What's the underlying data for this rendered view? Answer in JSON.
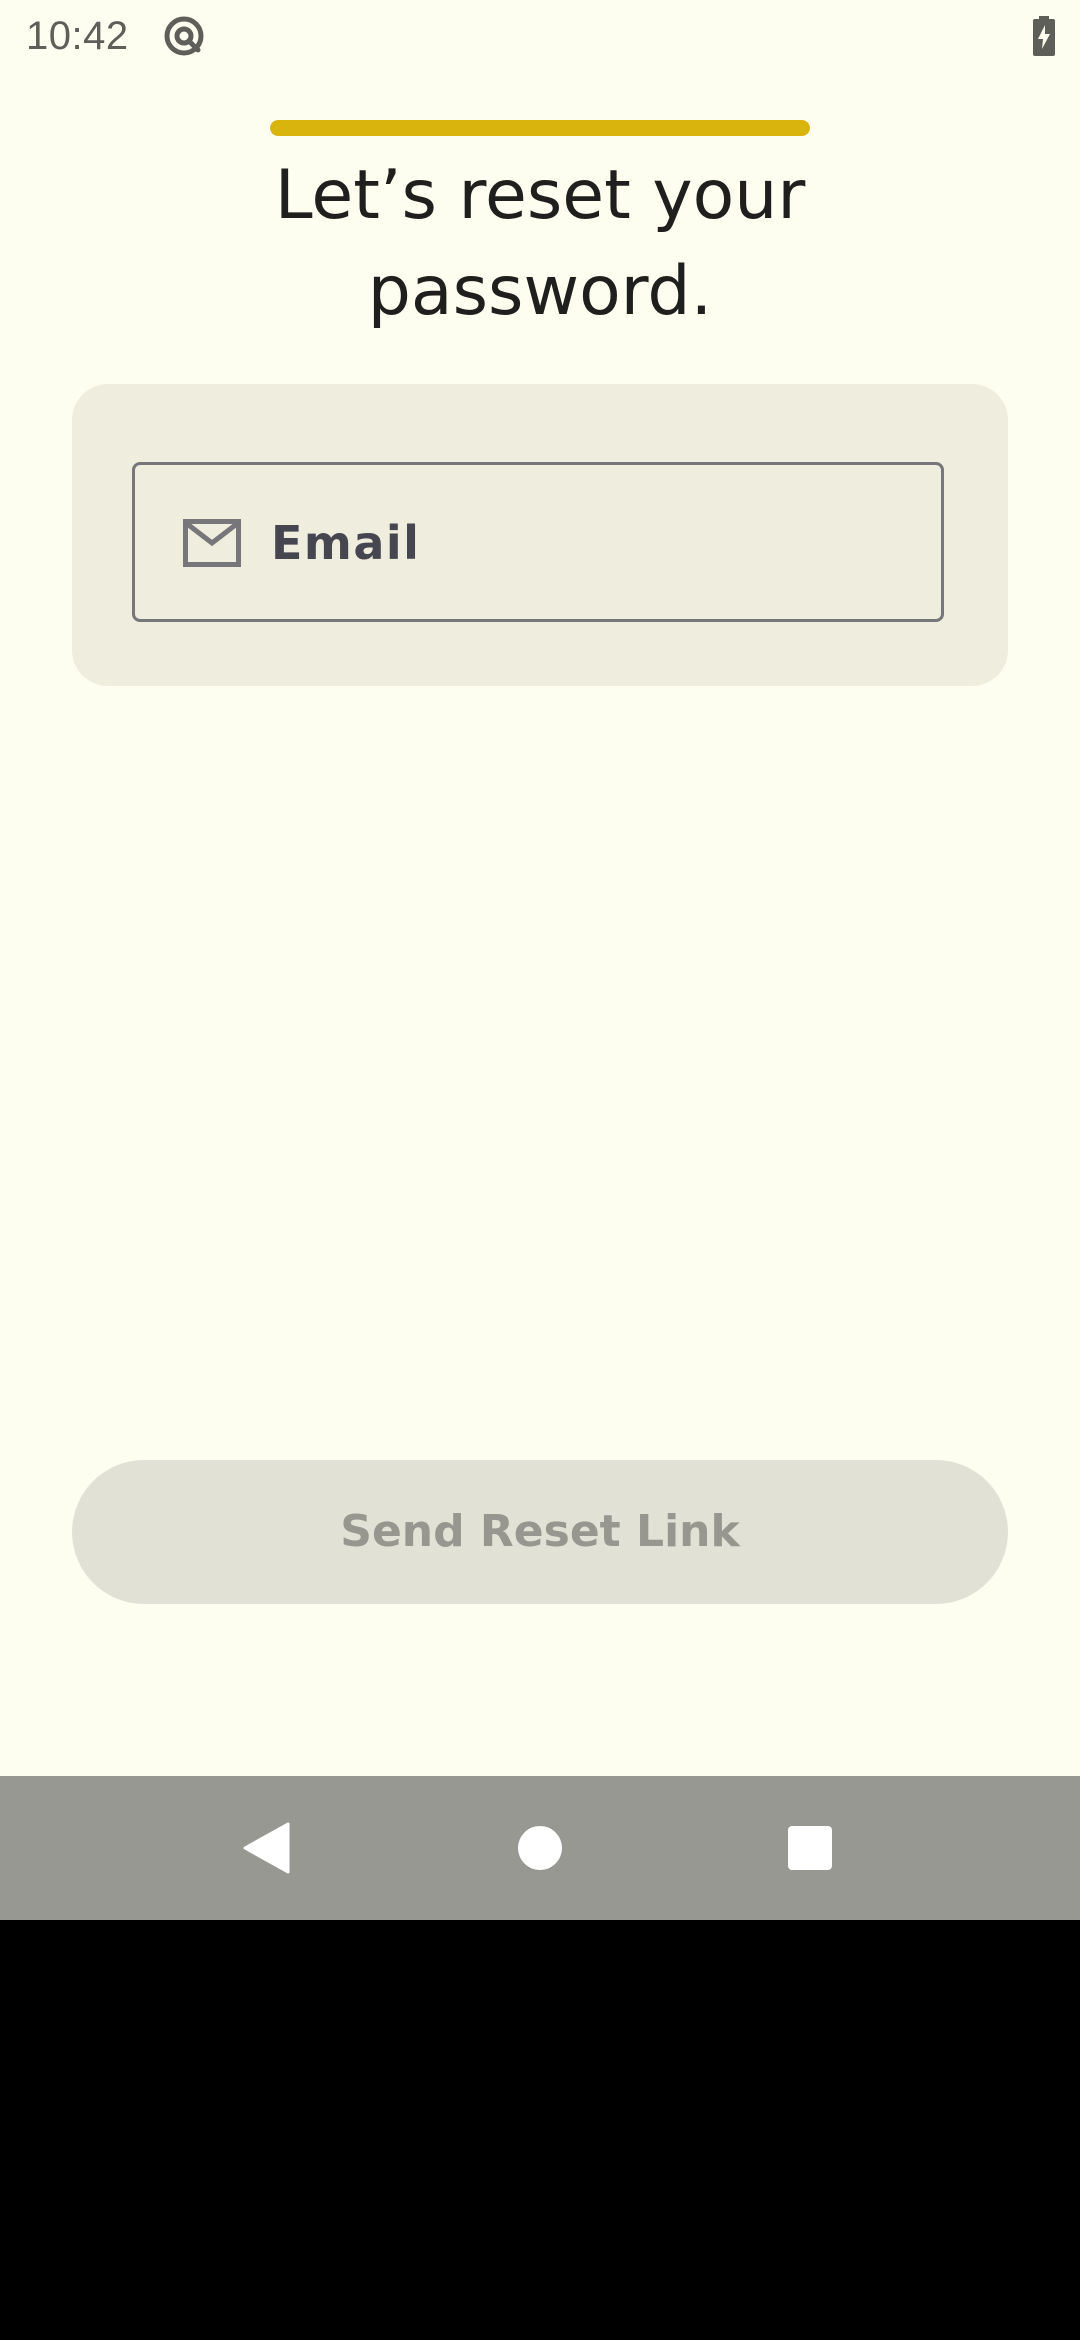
{
  "status_bar": {
    "time": "10:42",
    "app_icon": "at-sign-icon",
    "battery_icon": "battery-charging-icon"
  },
  "progress": {
    "fraction": 1.0,
    "color": "#D8B40C"
  },
  "title": "Let’s reset your password.",
  "email_field": {
    "label": "Email",
    "icon": "mail-icon",
    "value": ""
  },
  "send_button": {
    "label": "Send Reset Link",
    "enabled": false
  },
  "nav_bar": {
    "back_icon": "back-triangle-icon",
    "home_icon": "home-circle-icon",
    "recents_icon": "recents-square-icon"
  },
  "colors": {
    "background": "#FDFDF0",
    "card": "#EFEDDE",
    "accent": "#D8B40C",
    "button_disabled": "#E2E1D5"
  }
}
